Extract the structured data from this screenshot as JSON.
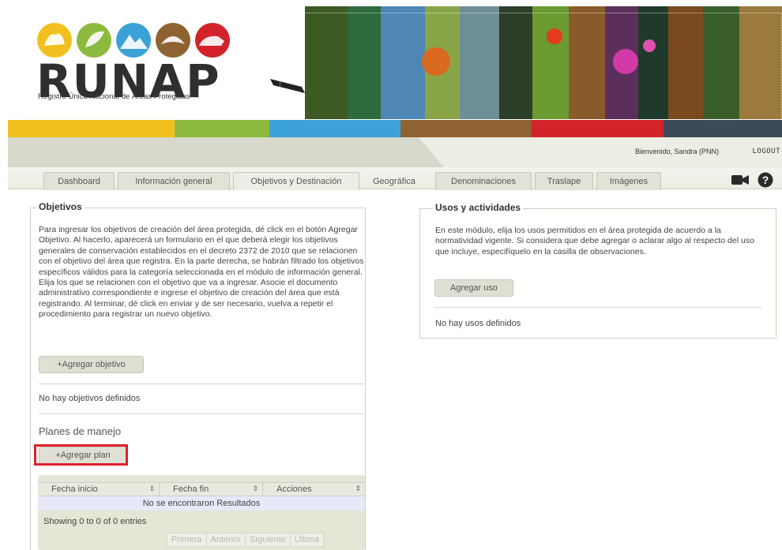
{
  "header": {
    "logo_title": "RUNAP",
    "logo_subtitle": "Registro Único Nacional de Áreas Protegidas",
    "welcome_text": "Bienvenido, Sandra (PNN)",
    "logout_label": "LOGOUT",
    "strip_colors": [
      "#f2c01e",
      "#8cba3f",
      "#3ba1d6",
      "#8f6331",
      "#d2232a",
      "#3c4a58"
    ]
  },
  "tabs": [
    {
      "label": "Dashboard"
    },
    {
      "label": "Información general"
    },
    {
      "label": "Objetivos y Destinación"
    },
    {
      "label": "Geográfica"
    },
    {
      "label": "Denominaciones"
    },
    {
      "label": "Traslape"
    },
    {
      "label": "Imágenes"
    }
  ],
  "objetivos": {
    "title": "Objetivos",
    "description": "Para ingresar los objetivos de creación del área protegida, dé click en el botón Agregar Objetivo. Al hacerlo, aparecerá un formulario en el que deberá elegir los objetivos generales de conservación establecidos en el decreto 2372 de 2010 que se relacionen con el objetivo del área que registra. En la parte derecha, se habrán filtrado los objetivos específicos válidos para la categoría seleccionada en el módulo de información general. Elija los que se relacionen con el objetivo que va a ingresar. Asocie el documento administrativo correspondiente e ingrese el objetivo de creación del área que está registrando. Al terminar, dé click en enviar y de ser necesario, vuelva a repetir el procedimiento para registrar un nuevo objetivo.",
    "add_button": "+Agregar objetivo",
    "empty_text": "No hay objetivos definidos"
  },
  "planes": {
    "title": "Planes de manejo",
    "add_button": "+Agregar plan",
    "columns": [
      "Fecha inicio",
      "Fecha fin",
      "Acciones"
    ],
    "no_results": "No se encontraron Resultados",
    "showing": "Showing 0 to 0 of 0 entries",
    "pager": [
      "Primera",
      "Anterior",
      "Siguiente",
      "Última"
    ]
  },
  "usos": {
    "title": "Usos y actividades",
    "description": "En este módulo, elija los usos permitidos en el área protegida de acuerdo a la normatividad vigente. Si considera que debe agregar o aclarar algo al respecto del uso que incluye, especifíquelo en la casilla de observaciones.",
    "add_button": "Agregar uso",
    "empty_text": "No hay usos definidos"
  }
}
